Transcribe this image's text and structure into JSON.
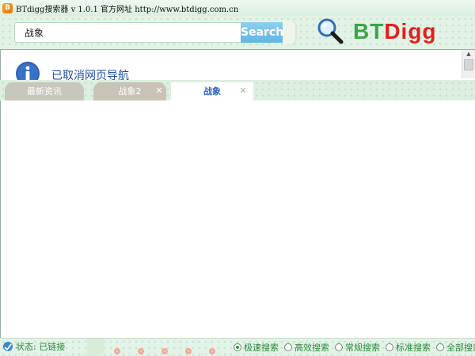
{
  "window": {
    "title": "BTdigg搜索器 v 1.0.1 官方网址 http://www.btdigg.com.cn",
    "icon": "app-icon"
  },
  "search": {
    "value": "战象",
    "placeholder": "",
    "button_label": "Search"
  },
  "logo": {
    "bt": "BT",
    "digg": "Digg",
    "icon": "magnifier-icon"
  },
  "content": {
    "message": "已取消网页导航",
    "icon": "info-icon"
  },
  "tabs": [
    {
      "label": "最新资讯",
      "closable": false,
      "active": false
    },
    {
      "label": "战象2",
      "closable": true,
      "active": false
    },
    {
      "label": "战象",
      "closable": true,
      "active": true
    }
  ],
  "status": {
    "text": "状态: 已链接",
    "icon": "connection-icon"
  },
  "modes": [
    {
      "label": "极速搜索",
      "selected": true
    },
    {
      "label": "高效搜索",
      "selected": false
    },
    {
      "label": "常规搜索",
      "selected": false
    },
    {
      "label": "标准搜索",
      "selected": false
    },
    {
      "label": "全部搜索",
      "selected": false
    }
  ],
  "colors": {
    "accent_green": "#3aa544",
    "accent_red": "#e01f1f",
    "search_blue": "#5fb6e2",
    "link_blue": "#1e4ea3",
    "status_green": "#2a8a3a"
  }
}
